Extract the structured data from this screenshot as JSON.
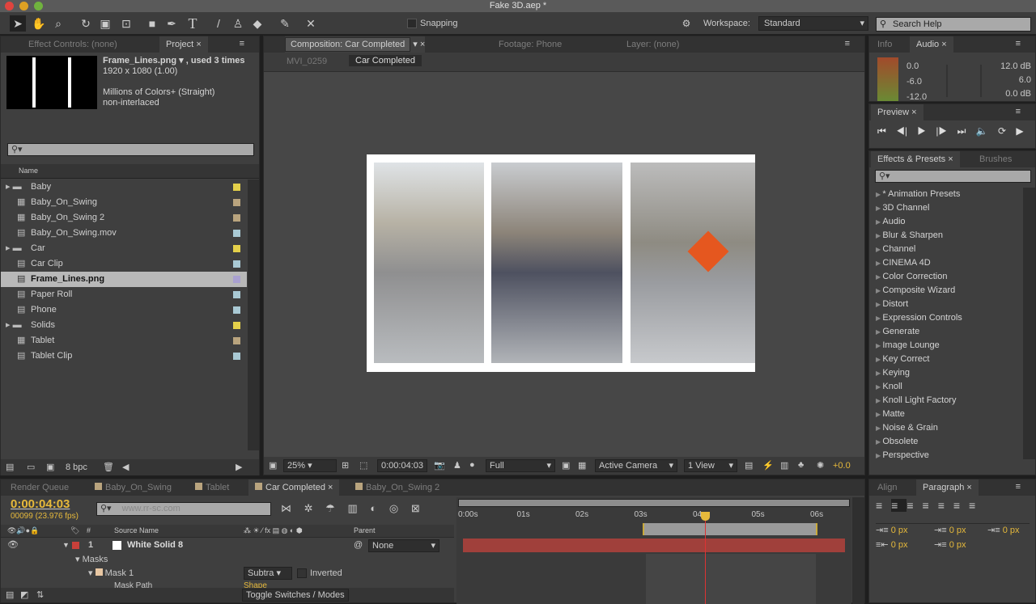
{
  "window": {
    "title": "Fake 3D.aep *"
  },
  "toolbar": {
    "snapping": "Snapping",
    "workspace_label": "Workspace:",
    "workspace_value": "Standard",
    "search_placeholder": "Search Help"
  },
  "project": {
    "tabs": [
      "Effect Controls: (none)",
      "Project"
    ],
    "selected_name": "Frame_Lines.png ▾ , used 3 times",
    "dims": "1920 x 1080 (1.00)",
    "colors": "Millions of Colors+ (Straight)",
    "interlace": "non-interlaced",
    "col_name": "Name",
    "bpc": "8 bpc",
    "items": [
      {
        "name": "Baby",
        "type": "folder",
        "color": "#e4d04a"
      },
      {
        "name": "Baby_On_Swing",
        "type": "comp",
        "color": "#b9a47e"
      },
      {
        "name": "Baby_On_Swing 2",
        "type": "comp",
        "color": "#b9a47e"
      },
      {
        "name": "Baby_On_Swing.mov",
        "type": "footage",
        "color": "#a9c9d4"
      },
      {
        "name": "Car",
        "type": "folder",
        "color": "#e4d04a"
      },
      {
        "name": "Car Clip",
        "type": "footage",
        "color": "#a9c9d4"
      },
      {
        "name": "Frame_Lines.png",
        "type": "footage",
        "color": "#a9a0d0",
        "selected": true
      },
      {
        "name": "Paper Roll",
        "type": "footage",
        "color": "#a9c9d4"
      },
      {
        "name": "Phone",
        "type": "footage",
        "color": "#a9c9d4"
      },
      {
        "name": "Solids",
        "type": "folder",
        "color": "#e4d04a"
      },
      {
        "name": "Tablet",
        "type": "comp",
        "color": "#b9a47e"
      },
      {
        "name": "Tablet Clip",
        "type": "footage",
        "color": "#a9c9d4"
      }
    ]
  },
  "comp": {
    "tab": "Composition: Car Completed",
    "footage_tab": "Footage: Phone",
    "layer_tab": "Layer: (none)",
    "breadcrumbs": [
      "MVI_0259",
      "Car Completed"
    ],
    "zoom": "25%",
    "time": "0:00:04:03",
    "resolution": "Full",
    "camera": "Active Camera",
    "views": "1 View",
    "exposure": "+0.0"
  },
  "audio": {
    "tabs": [
      "Info",
      "Audio"
    ],
    "left": [
      "0.0",
      "-6.0",
      "-12.0"
    ],
    "right": [
      "12.0 dB",
      "6.0",
      "0.0 dB"
    ]
  },
  "preview": {
    "tab": "Preview"
  },
  "effects": {
    "tabs": [
      "Effects & Presets",
      "Brushes"
    ],
    "items": [
      "* Animation Presets",
      "3D Channel",
      "Audio",
      "Blur & Sharpen",
      "Channel",
      "CINEMA 4D",
      "Color Correction",
      "Composite Wizard",
      "Distort",
      "Expression Controls",
      "Generate",
      "Image Lounge",
      "Key Correct",
      "Keying",
      "Knoll",
      "Knoll Light Factory",
      "Matte",
      "Noise & Grain",
      "Obsolete",
      "Perspective"
    ]
  },
  "timeline": {
    "tabs": [
      "Render Queue",
      "Baby_On_Swing",
      "Tablet",
      "Car Completed",
      "Baby_On_Swing 2"
    ],
    "timecode": "0:00:04:03",
    "frames": "00099 (23.976 fps)",
    "search_text": "www.rr-sc.com",
    "headers": {
      "source": "Source Name",
      "parent": "Parent",
      "num": "#"
    },
    "layer": {
      "num": "1",
      "name": "White Solid 8",
      "parent": "None"
    },
    "masks": "Masks",
    "mask1": "Mask 1",
    "mode": "Subtra",
    "inverted": "Inverted",
    "mask_path": "Mask Path",
    "shape": "Shape",
    "toggle": "Toggle Switches / Modes",
    "ruler": [
      "0:00s",
      "01s",
      "02s",
      "03s",
      "04",
      "05s",
      "06s"
    ],
    "current_seconds": 4.13
  },
  "paragraph": {
    "tabs": [
      "Align",
      "Paragraph"
    ],
    "values": [
      "0 px",
      "0 px",
      "0 px",
      "0 px",
      "0 px"
    ]
  }
}
